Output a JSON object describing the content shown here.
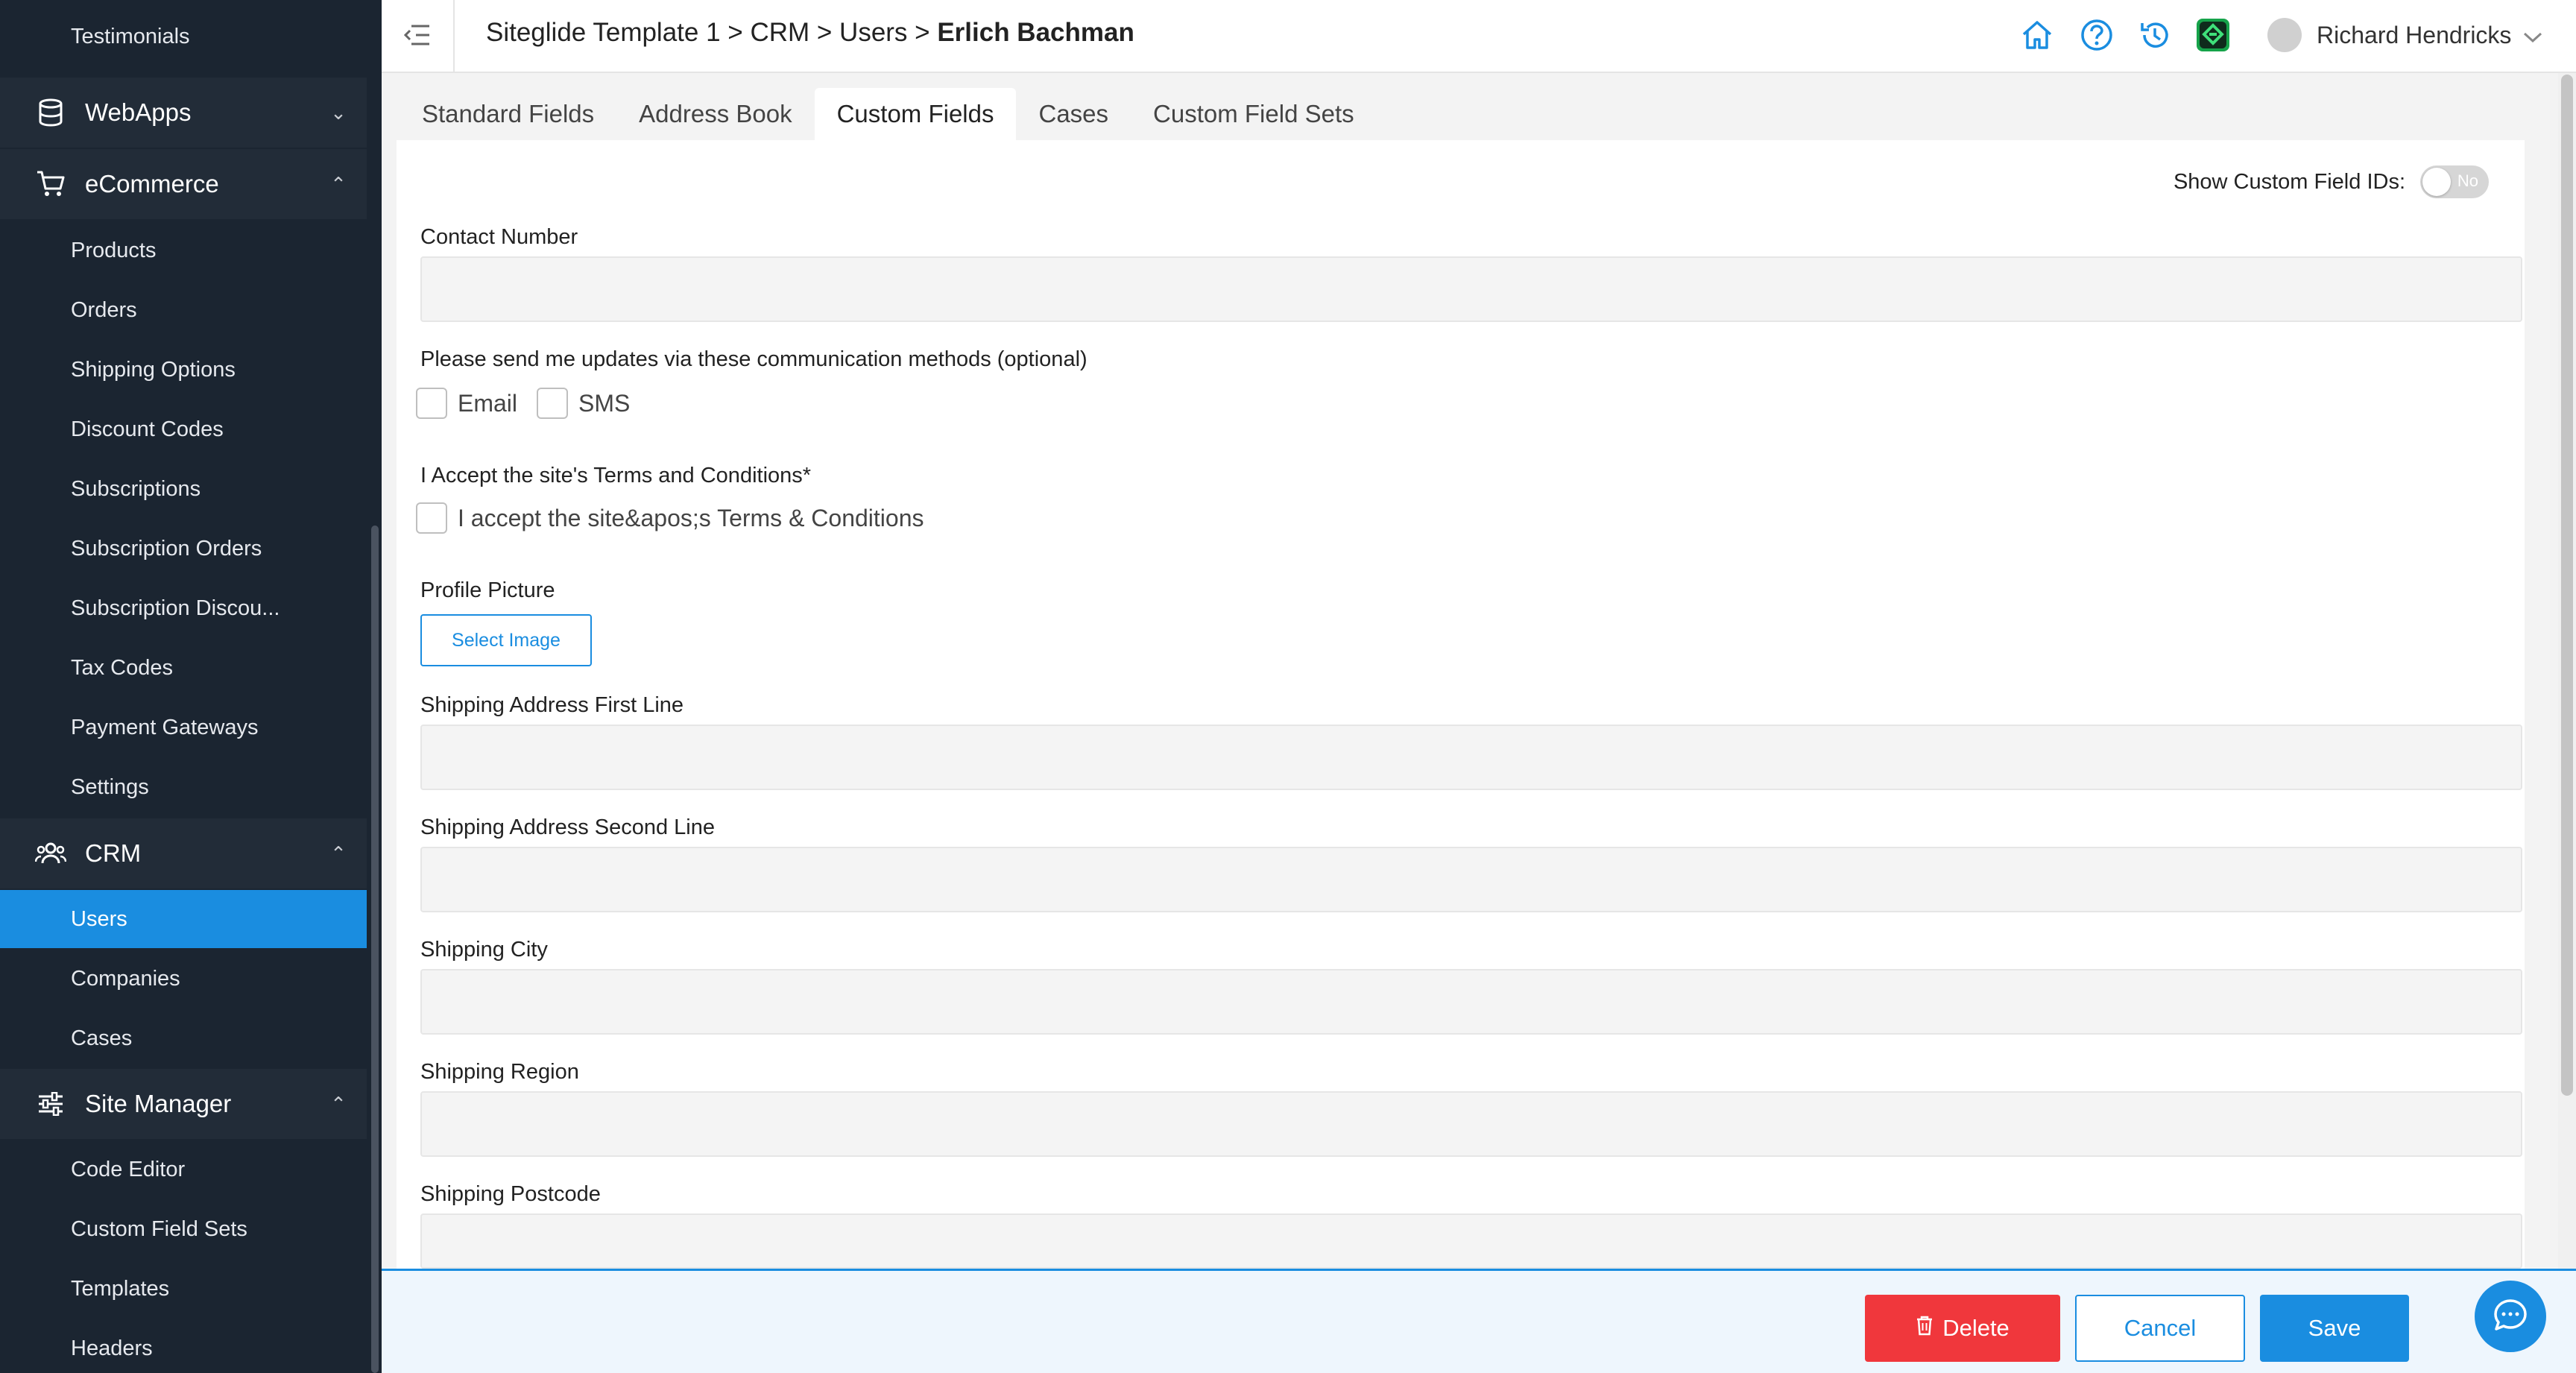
{
  "sidebar": {
    "top_items": [
      {
        "label": "Testimonials"
      }
    ],
    "groups": {
      "webapps": {
        "label": "WebApps"
      },
      "ecommerce": {
        "label": "eCommerce"
      },
      "crm": {
        "label": "CRM"
      },
      "site_manager": {
        "label": "Site Manager"
      }
    },
    "ecommerce_items": [
      "Products",
      "Orders",
      "Shipping Options",
      "Discount Codes",
      "Subscriptions",
      "Subscription Orders",
      "Subscription Discou...",
      "Tax Codes",
      "Payment Gateways",
      "Settings"
    ],
    "crm_items": [
      "Users",
      "Companies",
      "Cases"
    ],
    "site_manager_items": [
      "Code Editor",
      "Custom Field Sets",
      "Templates",
      "Headers"
    ]
  },
  "header": {
    "breadcrumb_path": "Siteglide Template 1 > CRM > Users > ",
    "breadcrumb_current": "Erlich Bachman",
    "user_name": "Richard Hendricks"
  },
  "tabs": [
    "Standard Fields",
    "Address Book",
    "Custom Fields",
    "Cases",
    "Custom Field Sets"
  ],
  "form": {
    "show_ids_label": "Show Custom Field IDs:",
    "show_ids_toggle": "No",
    "contact_number_label": "Contact Number",
    "updates_label": "Please send me updates via these communication methods (optional)",
    "email_option": "Email",
    "sms_option": "SMS",
    "terms_label": "I Accept the site's Terms and Conditions*",
    "terms_option": "I accept the site&apos;s Terms & Conditions",
    "profile_picture_label": "Profile Picture",
    "select_image_button": "Select Image",
    "shipping_first_label": "Shipping Address First Line",
    "shipping_second_label": "Shipping Address Second Line",
    "shipping_city_label": "Shipping City",
    "shipping_region_label": "Shipping Region",
    "shipping_postcode_label": "Shipping Postcode"
  },
  "footer": {
    "delete_label": "Delete",
    "cancel_label": "Cancel",
    "save_label": "Save"
  },
  "colors": {
    "sidebar_bg": "#1b2531",
    "accent": "#1a8de0",
    "danger": "#f0373c"
  }
}
